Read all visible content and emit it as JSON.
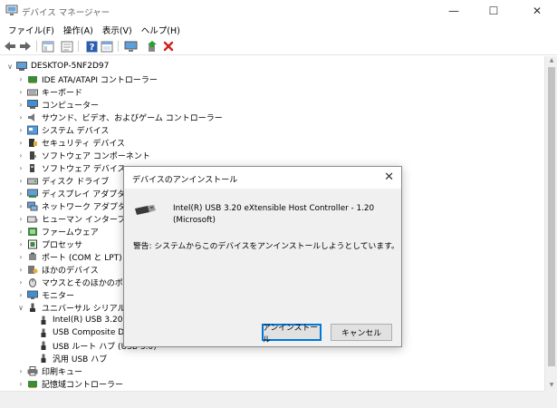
{
  "window": {
    "title": "デバイス マネージャー",
    "minimize": "—",
    "maximize": "☐",
    "close": "✕"
  },
  "menu": [
    "ファイル(F)",
    "操作(A)",
    "表示(V)",
    "ヘルプ(H)"
  ],
  "toolbar_icons": [
    "back-arrow-icon",
    "forward-arrow-icon",
    "show-hide-icon",
    "properties-icon",
    "help-icon",
    "view-icon",
    "monitor-icon",
    "add-driver-icon",
    "uninstall-x-icon"
  ],
  "tree": {
    "root": "DESKTOP-5NF2D97",
    "items": [
      {
        "label": "IDE ATA/ATAPI コントローラー",
        "expanded": false
      },
      {
        "label": "キーボード",
        "expanded": false
      },
      {
        "label": "コンピューター",
        "expanded": false
      },
      {
        "label": "サウンド、ビデオ、およびゲーム コントローラー",
        "expanded": false
      },
      {
        "label": "システム デバイス",
        "expanded": false
      },
      {
        "label": "セキュリティ デバイス",
        "expanded": false
      },
      {
        "label": "ソフトウェア コンポーネント",
        "expanded": false
      },
      {
        "label": "ソフトウェア デバイス",
        "expanded": false
      },
      {
        "label": "ディスク ドライブ",
        "expanded": false
      },
      {
        "label": "ディスプレイ アダプター",
        "expanded": false
      },
      {
        "label": "ネットワーク アダプター",
        "expanded": false
      },
      {
        "label": "ヒューマン インターフェイス デバイス",
        "expanded": false
      },
      {
        "label": "ファームウェア",
        "expanded": false
      },
      {
        "label": "プロセッサ",
        "expanded": false
      },
      {
        "label": "ポート (COM と LPT)",
        "expanded": false
      },
      {
        "label": "ほかのデバイス",
        "expanded": false
      },
      {
        "label": "マウスとそのほかのポインティング デバイス",
        "expanded": false
      },
      {
        "label": "モニター",
        "expanded": false
      },
      {
        "label": "ユニバーサル シリアル バス コントローラー",
        "expanded": true
      }
    ],
    "usb_children": [
      "Intel(R) USB 3.20 eXtensible Host Controller - 1.20 (Microsoft)",
      "USB Composite Device",
      "USB ルート ハブ (USB 3.0)",
      "汎用 USB ハブ"
    ],
    "after_items": [
      {
        "label": "印刷キュー",
        "expanded": false
      },
      {
        "label": "記憶域コントローラー",
        "expanded": false
      }
    ]
  },
  "dialog": {
    "title": "デバイスのアンインストール",
    "close": "✕",
    "device_name": "Intel(R) USB 3.20 eXtensible Host Controller - 1.20 (Microsoft)",
    "warning": "警告: システムからこのデバイスをアンインストールしようとしています。",
    "uninstall_button": "アンインストール",
    "cancel_button": "キャンセル"
  }
}
